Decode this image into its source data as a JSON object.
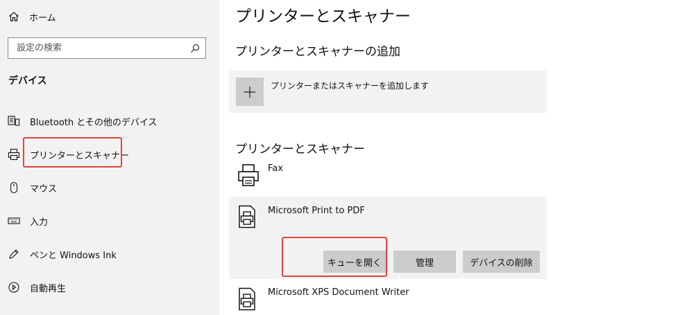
{
  "sidebar": {
    "home_label": "ホーム",
    "search_placeholder": "設定の検索",
    "section_title": "デバイス",
    "items": [
      {
        "label": "Bluetooth とその他のデバイス",
        "icon": "bluetooth-devices-icon"
      },
      {
        "label": "プリンターとスキャナー",
        "icon": "printer-icon",
        "selected": true
      },
      {
        "label": "マウス",
        "icon": "mouse-icon"
      },
      {
        "label": "入力",
        "icon": "keyboard-icon"
      },
      {
        "label": "ペンと Windows Ink",
        "icon": "pen-icon"
      },
      {
        "label": "自動再生",
        "icon": "autoplay-icon"
      }
    ]
  },
  "main": {
    "title": "プリンターとスキャナー",
    "add_section_title": "プリンターとスキャナーの追加",
    "add_button_label": "プリンターまたはスキャナーを追加します",
    "list_section_title": "プリンターとスキャナー",
    "devices": [
      {
        "name": "Fax",
        "icon": "fax-icon"
      },
      {
        "name": "Microsoft Print to PDF",
        "icon": "printer-icon",
        "selected": true
      },
      {
        "name": "Microsoft XPS Document Writer",
        "icon": "printer-icon"
      }
    ],
    "actions": {
      "open_queue": "キューを開く",
      "manage": "管理",
      "remove": "デバイスの削除"
    }
  },
  "colors": {
    "sidebar_bg": "#f2f2f2",
    "button_bg": "#cccccc",
    "highlight_border": "#e0453a"
  }
}
